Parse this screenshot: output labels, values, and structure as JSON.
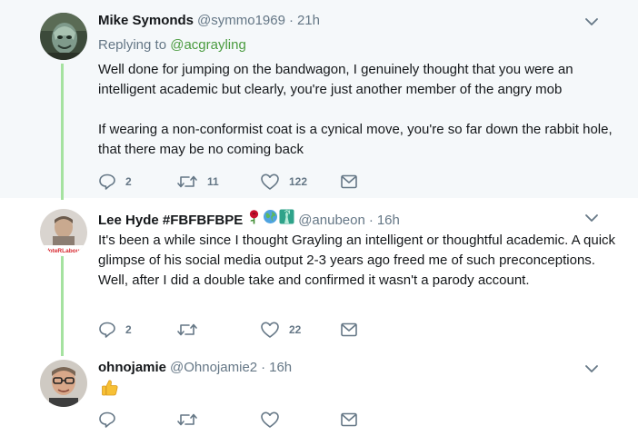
{
  "tweets": [
    {
      "name": "Mike Symonds",
      "handle": "@symmo1969",
      "separator": "·",
      "time": "21h",
      "reply_prefix": "Replying to",
      "reply_mention": "@acgrayling",
      "paragraphs": [
        "Well done for jumping on the bandwagon, I genuinely thought that you were an intelligent academic but clearly, you're just another member of the angry mob",
        "If wearing a non-conformist coat is a cynical move, you're so far down the rabbit hole, that there may be no coming back"
      ],
      "replies": "2",
      "retweets": "11",
      "likes": "122"
    },
    {
      "name": "Lee Hyde #FBFBFBPE",
      "badge_emojis": [
        "rose",
        "globe",
        "statue-of-liberty"
      ],
      "handle": "@anubeon",
      "separator": "·",
      "time": "16h",
      "avatar_text": "VoteRLabour",
      "paragraphs": [
        "It's been a while since I thought Grayling an intelligent or thoughtful academic. A quick glimpse of his social media output 2-3 years ago freed me of such preconceptions. Well, after I did a double take and confirmed it wasn't a parody account."
      ],
      "replies": "2",
      "retweets": "",
      "likes": "22"
    },
    {
      "name": "ohnojamie",
      "handle": "@Ohnojamie2",
      "separator": "·",
      "time": "16h",
      "content_emoji": "thumbs-up",
      "replies": "",
      "retweets": "",
      "likes": ""
    }
  ],
  "colors": {
    "thread_line": "#a5e2a0",
    "mention": "#4a9b3f",
    "muted": "#657786",
    "focused_bg": "#f5f8fa"
  },
  "icons": [
    "chevron-down-icon",
    "reply-icon",
    "retweet-icon",
    "like-icon",
    "dm-icon"
  ]
}
